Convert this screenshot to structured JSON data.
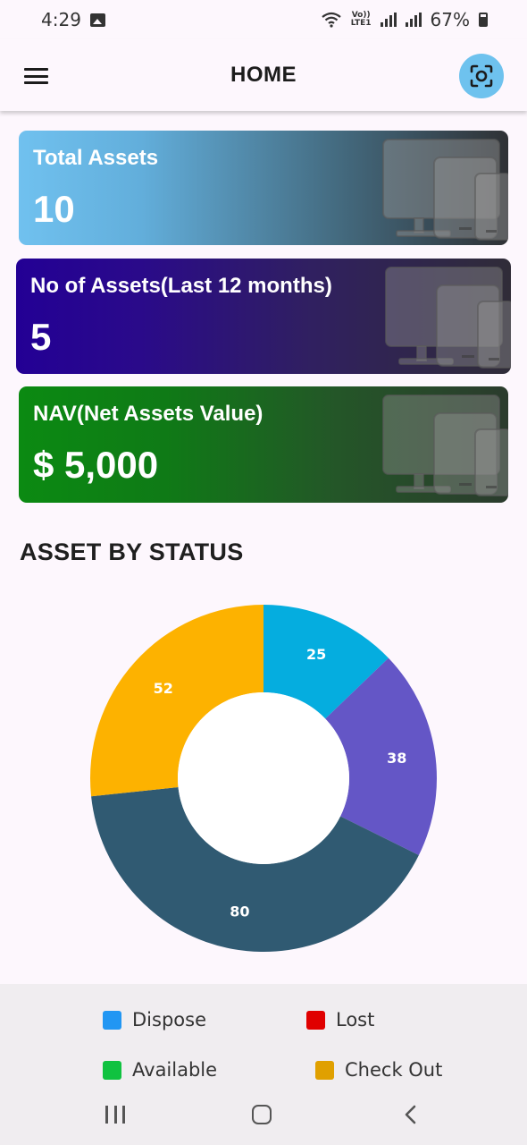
{
  "status_bar": {
    "time": "4:29",
    "volte_top": "Vo))",
    "volte_bottom": "LTE1",
    "battery": "67%",
    "icons": [
      "gallery-icon",
      "wifi-icon",
      "signal-icon",
      "battery-icon"
    ]
  },
  "app_bar": {
    "title": "HOME",
    "icons": [
      "menu-icon",
      "scan-icon"
    ]
  },
  "cards": [
    {
      "label": "Total Assets",
      "value": "10"
    },
    {
      "label": "No of Assets(Last 12 months)",
      "value": "5"
    },
    {
      "label": "NAV(Net Assets Value)",
      "value": "$ 5,000"
    }
  ],
  "section_title": "ASSET BY STATUS",
  "chart_data": {
    "type": "pie",
    "donut": true,
    "values": [
      25,
      38,
      80,
      52
    ],
    "colors": [
      "#05addf",
      "#6456c6",
      "#305a72",
      "#fdb200"
    ]
  },
  "legend": [
    {
      "label": "Dispose",
      "color": "#2196f3"
    },
    {
      "label": "Lost",
      "color": "#e00000"
    },
    {
      "label": "Available",
      "color": "#10c240"
    },
    {
      "label": "Check Out",
      "color": "#e0a000"
    }
  ],
  "nav_bar": {
    "icons": [
      "recents-icon",
      "home-icon",
      "back-icon"
    ]
  }
}
